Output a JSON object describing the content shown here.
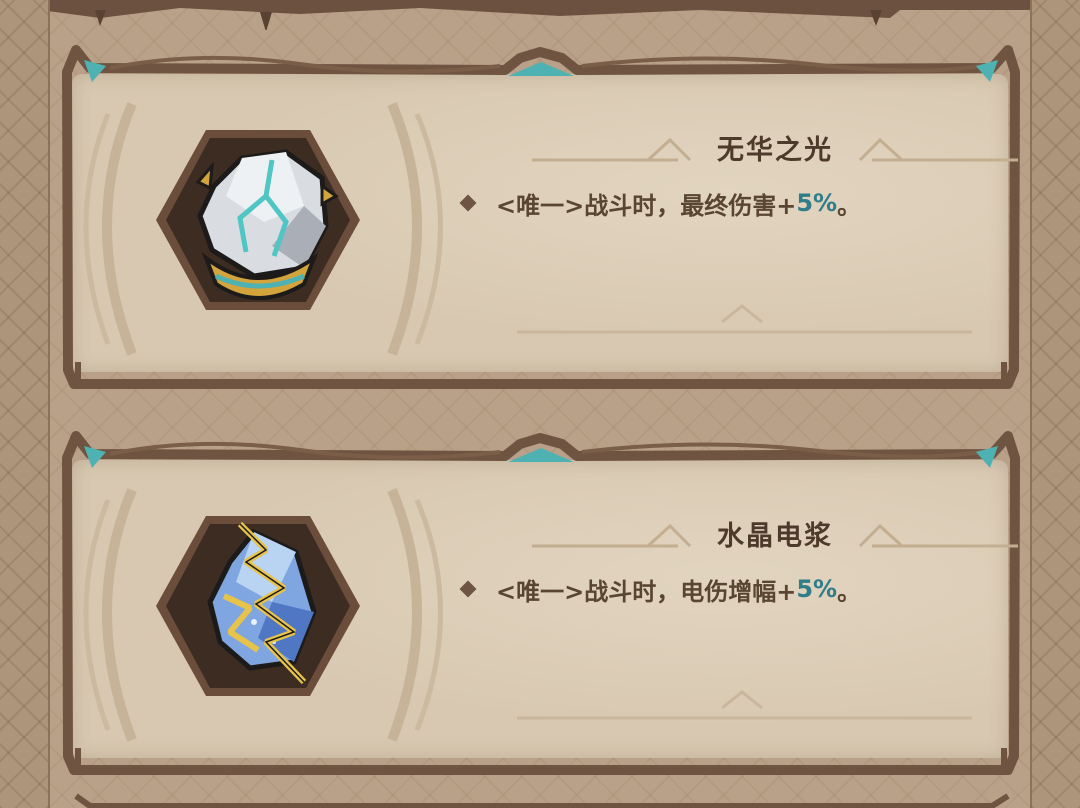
{
  "colors": {
    "panel_bg": "#d8c8b1",
    "frame_brown": "#6f5441",
    "accent_teal": "#4fb2b2",
    "text_dark": "#4e3a2a",
    "value_teal": "#2f7d8a"
  },
  "cards": [
    {
      "title": "无华之光",
      "icon": "cracked-stone-gem-icon",
      "effect": {
        "prefix": "<唯一>战斗时，最终伤害+",
        "value": "5%",
        "suffix": "。"
      }
    },
    {
      "title": "水晶电浆",
      "icon": "lightning-crystal-icon",
      "effect": {
        "prefix": "<唯一>战斗时，电伤增幅+",
        "value": "5%",
        "suffix": "。"
      }
    }
  ]
}
